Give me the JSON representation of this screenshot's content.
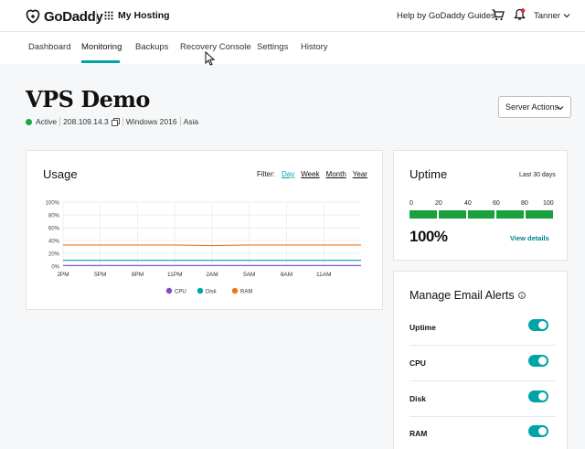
{
  "header": {
    "brand": "GoDaddy",
    "product": "My Hosting",
    "help": "Help by GoDaddy Guides",
    "user": "Tanner"
  },
  "nav": {
    "tabs": [
      "Dashboard",
      "Monitoring",
      "Backups",
      "Recovery Console",
      "Settings",
      "History"
    ],
    "active": "Monitoring"
  },
  "server": {
    "name": "VPS Demo",
    "status": "Active",
    "ip": "208.109.14.3",
    "os": "Windows 2016",
    "region": "Asia",
    "actions_label": "Server Actions"
  },
  "usage": {
    "title": "Usage",
    "filter_label": "Filter:",
    "filters": [
      "Day",
      "Week",
      "Month",
      "Year"
    ],
    "active_filter": "Day"
  },
  "chart_data": {
    "type": "line",
    "x": [
      "2PM",
      "5PM",
      "8PM",
      "11PM",
      "2AM",
      "5AM",
      "8AM",
      "11AM"
    ],
    "yticks": [
      "100%",
      "80%",
      "60%",
      "40%",
      "20%",
      "0%"
    ],
    "ylim": [
      0,
      100
    ],
    "series": [
      {
        "name": "CPU",
        "color": "#7b4fc9",
        "values": [
          1,
          1,
          1,
          1,
          1,
          1,
          1,
          1,
          1
        ]
      },
      {
        "name": "Disk",
        "color": "#00a4a6",
        "values": [
          9,
          9,
          9,
          9,
          9,
          9,
          9,
          9,
          9
        ]
      },
      {
        "name": "RAM",
        "color": "#f07419",
        "values": [
          33,
          33,
          33,
          33,
          32,
          33,
          33,
          33,
          33
        ]
      }
    ],
    "legend": "bottom"
  },
  "uptime": {
    "title": "Uptime",
    "range": "Last 30 days",
    "ticks": [
      "0",
      "20",
      "40",
      "60",
      "80",
      "100"
    ],
    "value": "100%",
    "percent": 100,
    "details": "View details"
  },
  "alerts": {
    "title": "Manage Email Alerts",
    "items": [
      {
        "label": "Uptime",
        "on": true
      },
      {
        "label": "CPU",
        "on": true
      },
      {
        "label": "Disk",
        "on": true
      },
      {
        "label": "RAM",
        "on": true
      }
    ]
  }
}
